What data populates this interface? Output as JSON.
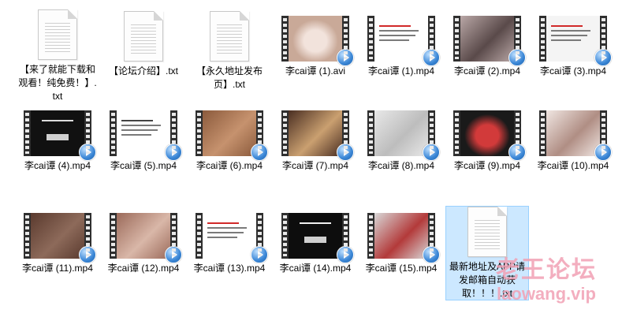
{
  "colors": {
    "selection": "#cce8ff",
    "film": "#2f2f2f",
    "play": "#3a86d6",
    "watermark": "#f1a1b4"
  },
  "files": [
    {
      "label": "【来了就能下载和观看！纯免费！】.txt",
      "type": "txt",
      "icon": "text-file-icon"
    },
    {
      "label": "【论坛介绍】.txt",
      "type": "txt",
      "icon": "text-file-icon"
    },
    {
      "label": "【永久地址发布页】.txt",
      "type": "txt",
      "icon": "text-file-icon"
    },
    {
      "label": "李cai谭 (1).avi",
      "type": "video",
      "icon": "video-file-icon",
      "thumb": {
        "bg": "#c9a998",
        "accent": "#f2e3dc",
        "scene": "face"
      }
    },
    {
      "label": "李cai谭 (1).mp4",
      "type": "video",
      "icon": "video-file-icon",
      "thumb": {
        "bg": "#ffffff",
        "accent": "#d12a2a",
        "scene": "text"
      }
    },
    {
      "label": "李cai谭 (2).mp4",
      "type": "video",
      "icon": "video-file-icon",
      "thumb": {
        "bg": "#b9a7a6",
        "accent": "#5a4a4a",
        "scene": "photo"
      }
    },
    {
      "label": "李cai谭 (3).mp4",
      "type": "video",
      "icon": "video-file-icon",
      "thumb": {
        "bg": "#f4f4f4",
        "accent": "#d12a2a",
        "scene": "text"
      }
    },
    {
      "label": "李cai谭 (4).mp4",
      "type": "video",
      "icon": "video-file-icon",
      "thumb": {
        "bg": "#111111",
        "accent": "#dddddd",
        "scene": "dark"
      }
    },
    {
      "label": "李cai谭 (5).mp4",
      "type": "video",
      "icon": "video-file-icon",
      "thumb": {
        "bg": "#ffffff",
        "accent": "#444444",
        "scene": "text"
      }
    },
    {
      "label": "李cai谭 (6).mp4",
      "type": "video",
      "icon": "video-file-icon",
      "thumb": {
        "bg": "#8b5a3c",
        "accent": "#c6926e",
        "scene": "photo"
      }
    },
    {
      "label": "李cai谭 (7).mp4",
      "type": "video",
      "icon": "video-file-icon",
      "thumb": {
        "bg": "#4a2e22",
        "accent": "#caa070",
        "scene": "photo"
      }
    },
    {
      "label": "李cai谭 (8).mp4",
      "type": "video",
      "icon": "video-file-icon",
      "thumb": {
        "bg": "#e8e8e8",
        "accent": "#bdbdbd",
        "scene": "photo"
      }
    },
    {
      "label": "李cai谭 (9).mp4",
      "type": "video",
      "icon": "video-file-icon",
      "thumb": {
        "bg": "#1a1a1a",
        "accent": "#d23a3a",
        "scene": "face"
      }
    },
    {
      "label": "李cai谭 (10).mp4",
      "type": "video",
      "icon": "video-file-icon",
      "thumb": {
        "bg": "#f0e6e2",
        "accent": "#b08e84",
        "scene": "photo"
      }
    },
    {
      "label": "李cai谭 (11).mp4",
      "type": "video",
      "icon": "video-file-icon",
      "thumb": {
        "bg": "#5a3a2e",
        "accent": "#8d6a5a",
        "scene": "photo"
      }
    },
    {
      "label": "李cai谭 (12).mp4",
      "type": "video",
      "icon": "video-file-icon",
      "thumb": {
        "bg": "#9b6a5a",
        "accent": "#d9b7a8",
        "scene": "photo"
      }
    },
    {
      "label": "李cai谭 (13).mp4",
      "type": "video",
      "icon": "video-file-icon",
      "thumb": {
        "bg": "#ffffff",
        "accent": "#d12a2a",
        "scene": "text"
      }
    },
    {
      "label": "李cai谭 (14).mp4",
      "type": "video",
      "icon": "video-file-icon",
      "thumb": {
        "bg": "#0d0d0d",
        "accent": "#f0f0f0",
        "scene": "dark"
      }
    },
    {
      "label": "李cai谭 (15).mp4",
      "type": "video",
      "icon": "video-file-icon",
      "thumb": {
        "bg": "#d8d8d8",
        "accent": "#b33a3a",
        "scene": "photo"
      }
    },
    {
      "label": "最新地址及APP请发邮箱自动获取！！！.txt",
      "type": "txt",
      "icon": "text-file-icon",
      "selected": true
    }
  ],
  "watermark": {
    "cn": "老王论坛",
    "en": "laowang.vip"
  }
}
